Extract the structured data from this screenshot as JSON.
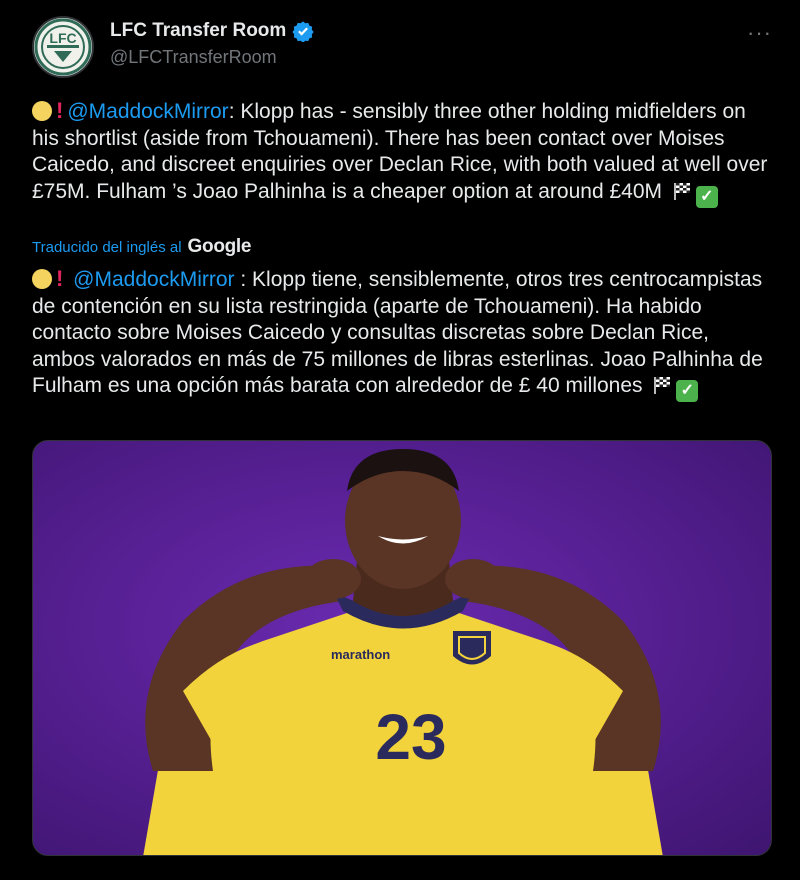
{
  "account": {
    "display_name": "LFC Transfer Room",
    "handle": "@LFCTransferRoom",
    "avatar_text": "LFC"
  },
  "tweet": {
    "mention": "@MaddockMirror",
    "text_line1_rest": ": Klopp has - sensibly three other holding",
    "text_rest": "midfielders on his shortlist (aside from Tchouameni). There has been contact over Moises Caicedo, and discreet enquiries over Declan Rice, with both valued at well over £75M. Fulham ’s Joao Palhinha is a cheaper option at around £40M"
  },
  "translation_label": "Traducido del inglés al",
  "translation_provider": "Google",
  "translation": {
    "mention": "@MaddockMirror",
    "text": " : Klopp tiene, sensiblemente, otros tres centrocampistas de contención en su lista restringida (aparte de Tchouameni). Ha habido contacto sobre Moises Caicedo y consultas discretas sobre Declan Rice, ambos valorados en más de 75 millones de libras esterlinas. Joao Palhinha de Fulham es una opción más barata con alrededor de £ 40 millones"
  },
  "photo": {
    "jersey_brand": "marathon",
    "jersey_number": "23"
  },
  "colors": {
    "background": "#000000",
    "link": "#1d9bf0",
    "secondary_text": "#71767b",
    "photo_background": "#5a2198",
    "jersey": "#f2d33b"
  },
  "icons": [
    "verified-badge-icon",
    "more-options-icon",
    "yellow-circle-emoji",
    "red-exclamation-emoji",
    "checkered-flag-emoji",
    "check-mark-emoji"
  ]
}
